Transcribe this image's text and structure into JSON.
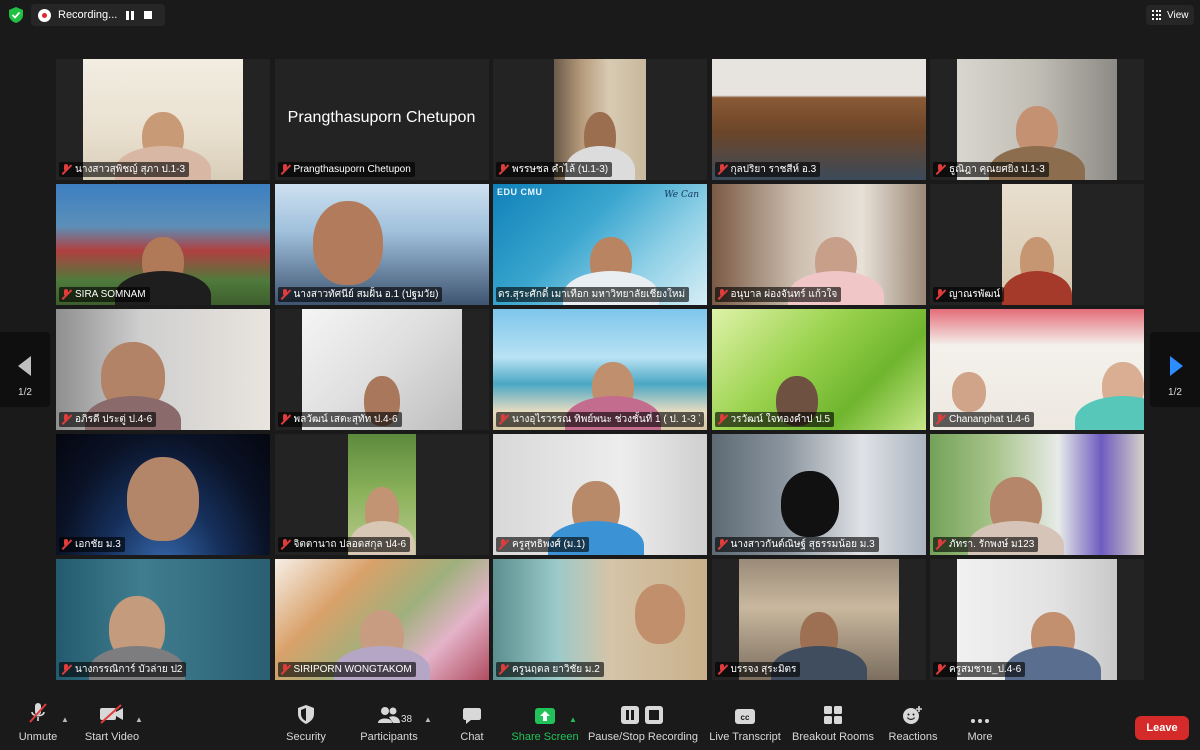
{
  "topbar": {
    "recording_label": "Recording...",
    "view_label": "View"
  },
  "pager": {
    "left_page": "1/2",
    "right_page": "1/2"
  },
  "tiles": [
    {
      "name": "นางสาวสุพิชญ์ สุภา ป.1-3"
    },
    {
      "name": "Prangthasuporn Chetupon",
      "display_name": "Prangthasuporn Chetupon"
    },
    {
      "name": "พรรษชล คำไล้ (ป.1-3)"
    },
    {
      "name": "กุลปริยา ราชสีห์ อ.3"
    },
    {
      "name": "ธูณิฎา คุณยศยิ่ง ป.1-3"
    },
    {
      "name": "SIRA SOMNAM"
    },
    {
      "name": "นางสาวทัศนีย์  สมฝั้น อ.1 (ปฐมวัย)"
    },
    {
      "name": "ดร.สุระศักดิ์ เมาเทือก มหาวิทยาลัยเชียงใหม่",
      "logo_text": "EDU CMU",
      "tag_text": "We Can"
    },
    {
      "name": "อนุบาล ผ่องจันทร์  แก้วใจ"
    },
    {
      "name": "ญาณรพัฒน์"
    },
    {
      "name": "อภิรดี  ประตู่ ป.4-6"
    },
    {
      "name": "พลวัฒน์  เสตะสุทัท ป.4-6"
    },
    {
      "name": "นางอุไรวรรณ ทิพย์พนะ ช่วงชั้นที่ 1 ( ป. 1-3 )"
    },
    {
      "name": "วรวัฒน์  ใจทองคำป ป.5"
    },
    {
      "name": "Chananphat ป.4-6"
    },
    {
      "name": "เอกชัย ม.3"
    },
    {
      "name": "จิตตานาถ ปลอดสกุล ป4-6"
    },
    {
      "name": "ครูสุทธิพงศ์ (ม.1)"
    },
    {
      "name": "นางสาวกันต์ณิษฐ์  สุธรรมน้อย  ม.3"
    },
    {
      "name": "ภัทรา. รักพงษ์ ม123"
    },
    {
      "name": "นางกรรณิการ์    บัวล่าย ป2"
    },
    {
      "name": "SIRIPORN WONGTAKOM"
    },
    {
      "name": "ครูนฤดล ยาวิชัย ม.2"
    },
    {
      "name": "บรรจง สุระมิตร"
    },
    {
      "name": "ครูสมชาย_ป.4-6"
    }
  ],
  "toolbar": {
    "unmute": "Unmute",
    "start_video": "Start Video",
    "security": "Security",
    "participants": "Participants",
    "participants_count": "38",
    "chat": "Chat",
    "share_screen": "Share Screen",
    "pause_stop_recording": "Pause/Stop Recording",
    "live_transcript": "Live Transcript",
    "breakout_rooms": "Breakout Rooms",
    "reactions": "Reactions",
    "more": "More",
    "leave": "Leave"
  },
  "colors": {
    "background": "#1a1a1a",
    "active_speaker_border": "#21c043",
    "share_screen_green": "#22c25a",
    "leave_red": "#d42a2a",
    "muted_red": "#e03c3c",
    "next_page_blue": "#2d8cff"
  }
}
